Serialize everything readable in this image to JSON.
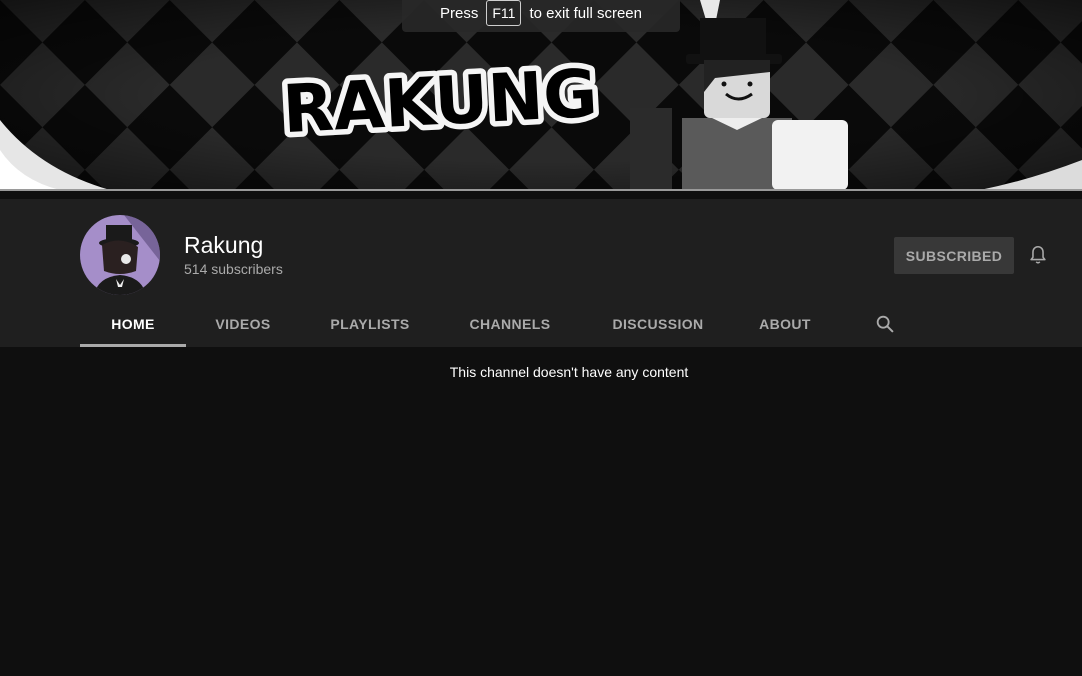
{
  "fullscreen_notice": {
    "press": "Press",
    "key": "F11",
    "suffix": "to exit full screen"
  },
  "banner": {
    "title": "RAKUNG"
  },
  "channel": {
    "name": "Rakung",
    "subscribers": "514 subscribers",
    "subscribe_label": "SUBSCRIBED"
  },
  "tabs": [
    {
      "label": "HOME",
      "active": true
    },
    {
      "label": "VIDEOS"
    },
    {
      "label": "PLAYLISTS"
    },
    {
      "label": "CHANNELS"
    },
    {
      "label": "DISCUSSION"
    },
    {
      "label": "ABOUT"
    }
  ],
  "icons": {
    "bell": "bell-icon",
    "search": "search-icon"
  },
  "content": {
    "empty_message": "This channel doesn't have any content"
  },
  "colors": {
    "background": "#0f0f0f",
    "header": "#1f1f1f",
    "subscribed_button": "#383838",
    "muted_text": "#aaaaaa"
  }
}
